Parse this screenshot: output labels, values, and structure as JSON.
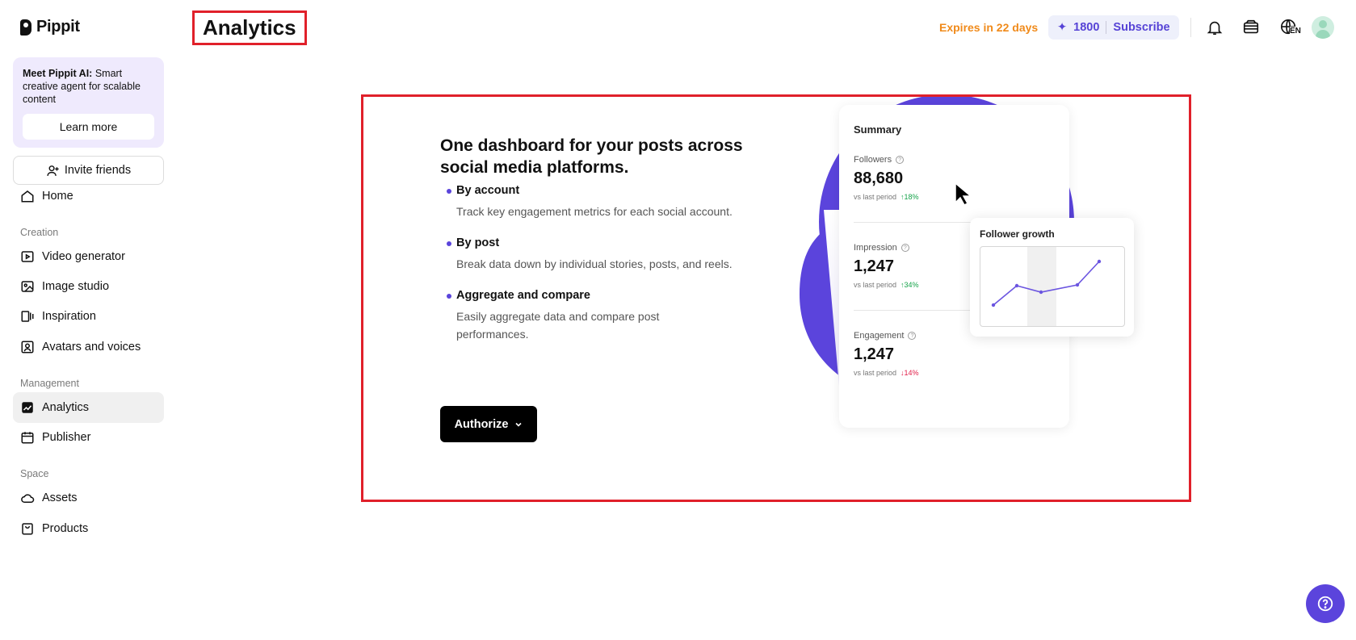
{
  "brand": {
    "name": "Pippit",
    "accent": "#5b44dc"
  },
  "sidebar": {
    "promo": {
      "bold": "Meet Pippit AI:",
      "text": " Smart creative agent for scalable content",
      "button": "Learn more"
    },
    "invite": "Invite friends",
    "home": "Home",
    "sections": {
      "creation": "Creation",
      "management": "Management",
      "space": "Space"
    },
    "creation_items": [
      "Video generator",
      "Image studio",
      "Inspiration",
      "Avatars and voices"
    ],
    "management_items": [
      "Analytics",
      "Publisher"
    ],
    "space_items": [
      "Assets",
      "Products"
    ]
  },
  "header": {
    "title": "Analytics",
    "expires": "Expires in 22 days",
    "credits": "1800",
    "subscribe": "Subscribe",
    "lang": "EN"
  },
  "main": {
    "headline": "One dashboard for your posts across social media platforms.",
    "features": [
      {
        "title": "By account",
        "desc": "Track key engagement metrics for each social account."
      },
      {
        "title": "By post",
        "desc": "Break data down by individual stories, posts, and reels."
      },
      {
        "title": "Aggregate and compare",
        "desc": "Easily aggregate data and compare post performances."
      }
    ],
    "authorize": "Authorize"
  },
  "summary": {
    "title": "Summary",
    "metrics": [
      {
        "label": "Followers",
        "value": "88,680",
        "vs": "vs last period",
        "change": "↑18%",
        "trend": "up"
      },
      {
        "label": "Impression",
        "value": "1,247",
        "vs": "vs last period",
        "change": "↑34%",
        "trend": "up"
      },
      {
        "label": "Engagement",
        "value": "1,247",
        "vs": "vs last period",
        "change": "↓14%",
        "trend": "down"
      }
    ]
  },
  "growth": {
    "title": "Follower growth"
  }
}
